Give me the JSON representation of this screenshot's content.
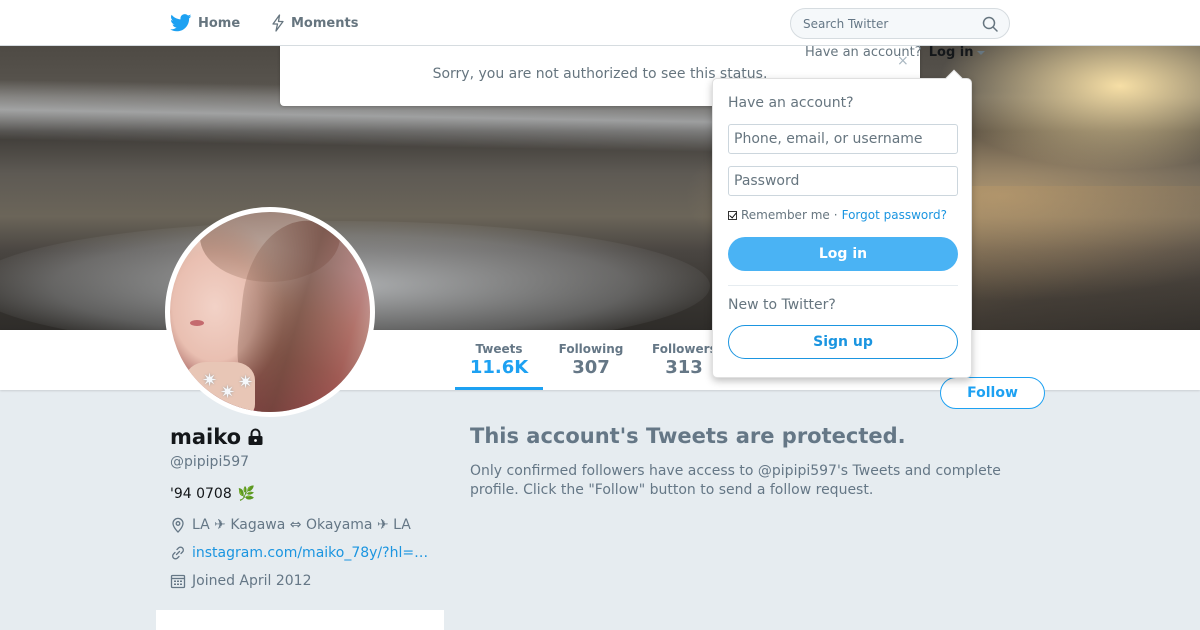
{
  "nav": {
    "home_label": "Home",
    "moments_label": "Moments",
    "search_placeholder": "Search Twitter"
  },
  "notice": {
    "text": "Sorry, you are not authorized to see this status.",
    "close_glyph": "×"
  },
  "login_prompt": {
    "have_account": "Have an account?",
    "login_label": "Log in"
  },
  "dropdown": {
    "heading": "Have an account?",
    "username_placeholder": "Phone, email, or username",
    "password_placeholder": "Password",
    "remember_label": "Remember me",
    "separator": "·",
    "forgot_label": "Forgot password?",
    "login_button": "Log in",
    "new_label": "New to Twitter?",
    "signup_button": "Sign up",
    "remember_checked": true
  },
  "stats": [
    {
      "label": "Tweets",
      "value": "11.6K"
    },
    {
      "label": "Following",
      "value": "307"
    },
    {
      "label": "Followers",
      "value": "313"
    }
  ],
  "follow_button": "Follow",
  "profile": {
    "name": "maiko",
    "handle": "@pipipi597",
    "bio": "'94 0708",
    "bio_emoji": "🌿",
    "location": "LA ✈ Kagawa ⇔ Okayama ✈ LA",
    "url": "instagram.com/maiko_78y/?hl=…",
    "joined": "Joined April 2012"
  },
  "protected": {
    "title": "This account's Tweets are protected.",
    "description": "Only confirmed followers have access to @pipipi597's Tweets and complete profile. Click the \"Follow\" button to send a follow request."
  },
  "colors": {
    "brand_blue": "#1da1f2",
    "link_blue": "#1b95e0",
    "background": "#e6ecf0",
    "muted_text": "#657786"
  }
}
